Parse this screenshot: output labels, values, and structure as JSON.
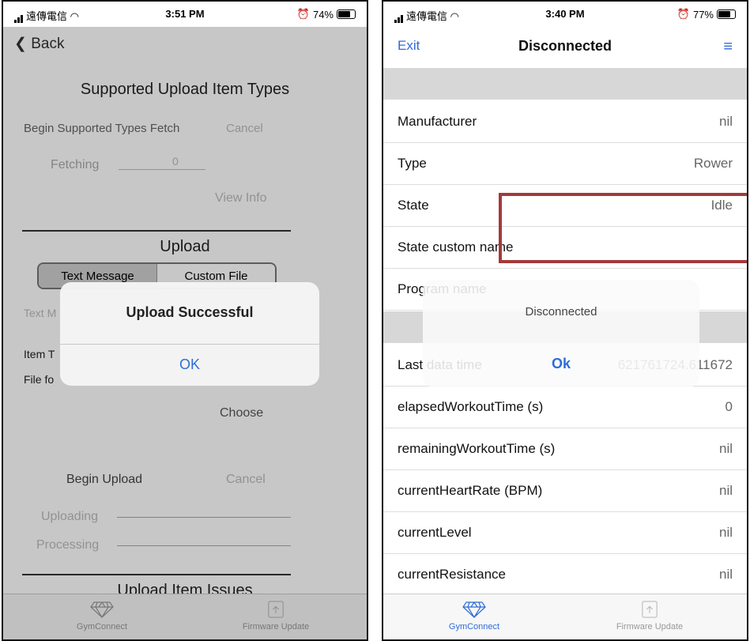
{
  "left": {
    "status": {
      "carrier": "遠傳電信",
      "time": "3:51 PM",
      "battery": "74%",
      "battery_level": 0.74
    },
    "back_label": "Back",
    "section_supported": "Supported Upload Item Types",
    "begin_fetch": "Begin Supported Types Fetch",
    "cancel_fetch": "Cancel",
    "fetching_label": "Fetching",
    "fetching_count": "0",
    "view_info": "View Info",
    "section_upload": "Upload",
    "seg_text_message": "Text Message",
    "seg_custom_file": "Custom File",
    "text_partial": "Text M",
    "item_partial": "Item T",
    "file_partial": "File fo",
    "choose": "Choose",
    "begin_upload": "Begin Upload",
    "cancel_upload": "Cancel",
    "uploading": "Uploading",
    "processing": "Processing",
    "section_issues": "Upload Item Issues",
    "alert_title": "Upload Successful",
    "alert_ok": "OK",
    "tab_gymconnect": "GymConnect",
    "tab_firmware": "Firmware Update"
  },
  "right": {
    "status": {
      "carrier": "遠傳電信",
      "time": "3:40 PM",
      "battery": "77%",
      "battery_level": 0.77
    },
    "exit_label": "Exit",
    "title": "Disconnected",
    "menu_icon": "≡",
    "rows": [
      {
        "k": "Manufacturer",
        "v": "nil"
      },
      {
        "k": "Type",
        "v": "Rower"
      },
      {
        "k": "State",
        "v": "Idle"
      },
      {
        "k": "State custom name",
        "v": ""
      },
      {
        "k": "Program name",
        "v": ""
      }
    ],
    "rows2": [
      {
        "k": "Last data time",
        "v": "621761724.611672"
      },
      {
        "k": "elapsedWorkoutTime (s)",
        "v": "0"
      },
      {
        "k": "remainingWorkoutTime (s)",
        "v": "nil"
      },
      {
        "k": "currentHeartRate (BPM)",
        "v": "nil"
      },
      {
        "k": "currentLevel",
        "v": "nil"
      },
      {
        "k": "currentResistance",
        "v": "nil"
      }
    ],
    "alert_title": "Disconnected",
    "alert_ok": "Ok",
    "tab_gymconnect": "GymConnect",
    "tab_firmware": "Firmware Update"
  }
}
